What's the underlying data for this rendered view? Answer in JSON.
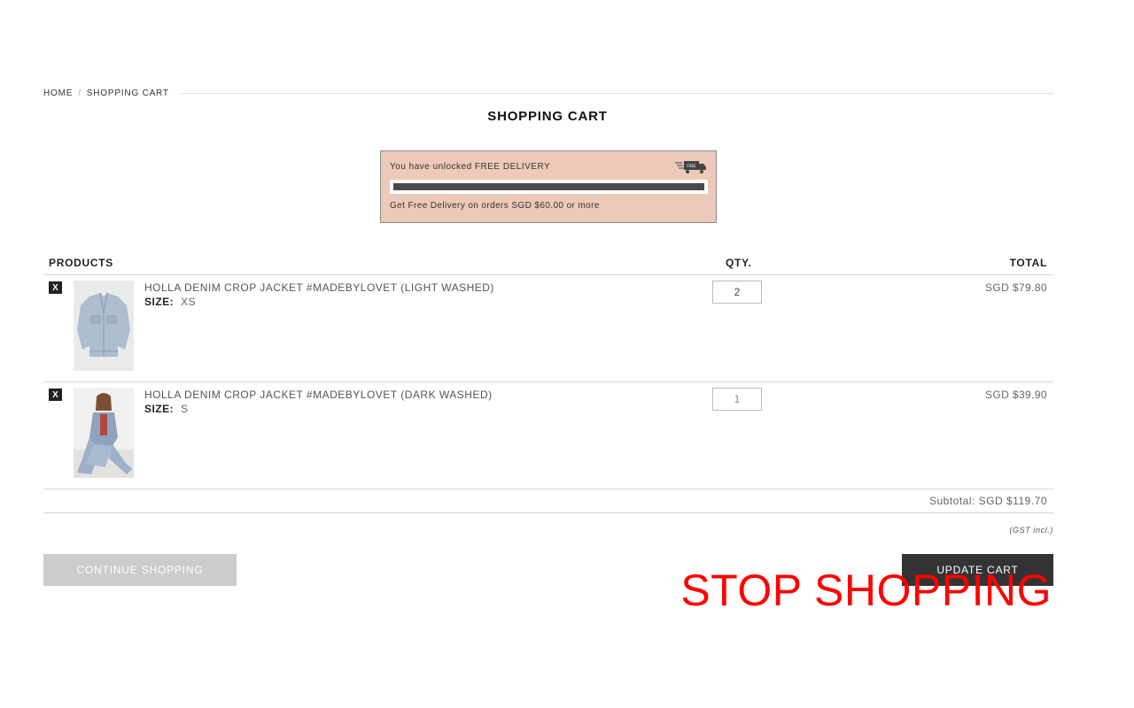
{
  "breadcrumb": {
    "home": "HOME",
    "separator": "/",
    "current": "SHOPPING CART"
  },
  "page_title": "SHOPPING CART",
  "free_delivery": {
    "message": "You have unlocked FREE DELIVERY",
    "truck_badge": "FREE",
    "progress_percent": 100,
    "note": "Get Free Delivery on orders SGD $60.00 or more",
    "box_color": "#ecc9b8",
    "bar_color": "#4a4a4a"
  },
  "cart": {
    "headers": {
      "products": "PRODUCTS",
      "qty": "QTY.",
      "total": "TOTAL"
    },
    "items": [
      {
        "remove": "X",
        "name": "HOLLA DENIM CROP JACKET #MADEBYLOVET (LIGHT WASHED)",
        "size_label": "SIZE:",
        "size": "XS",
        "qty": "2",
        "total": "SGD $79.80"
      },
      {
        "remove": "X",
        "name": "HOLLA DENIM CROP JACKET #MADEBYLOVET (DARK WASHED)",
        "size_label": "SIZE:",
        "size": "S",
        "qty": "1",
        "total": "SGD $39.90"
      }
    ],
    "subtotal": "Subtotal: SGD $119.70",
    "gst_note": "(GST incl.)"
  },
  "buttons": {
    "continue": "CONTINUE SHOPPING",
    "update": "UPDATE CART"
  },
  "overlay_text": "STOP SHOPPING",
  "overlay_color": "#ff0000"
}
